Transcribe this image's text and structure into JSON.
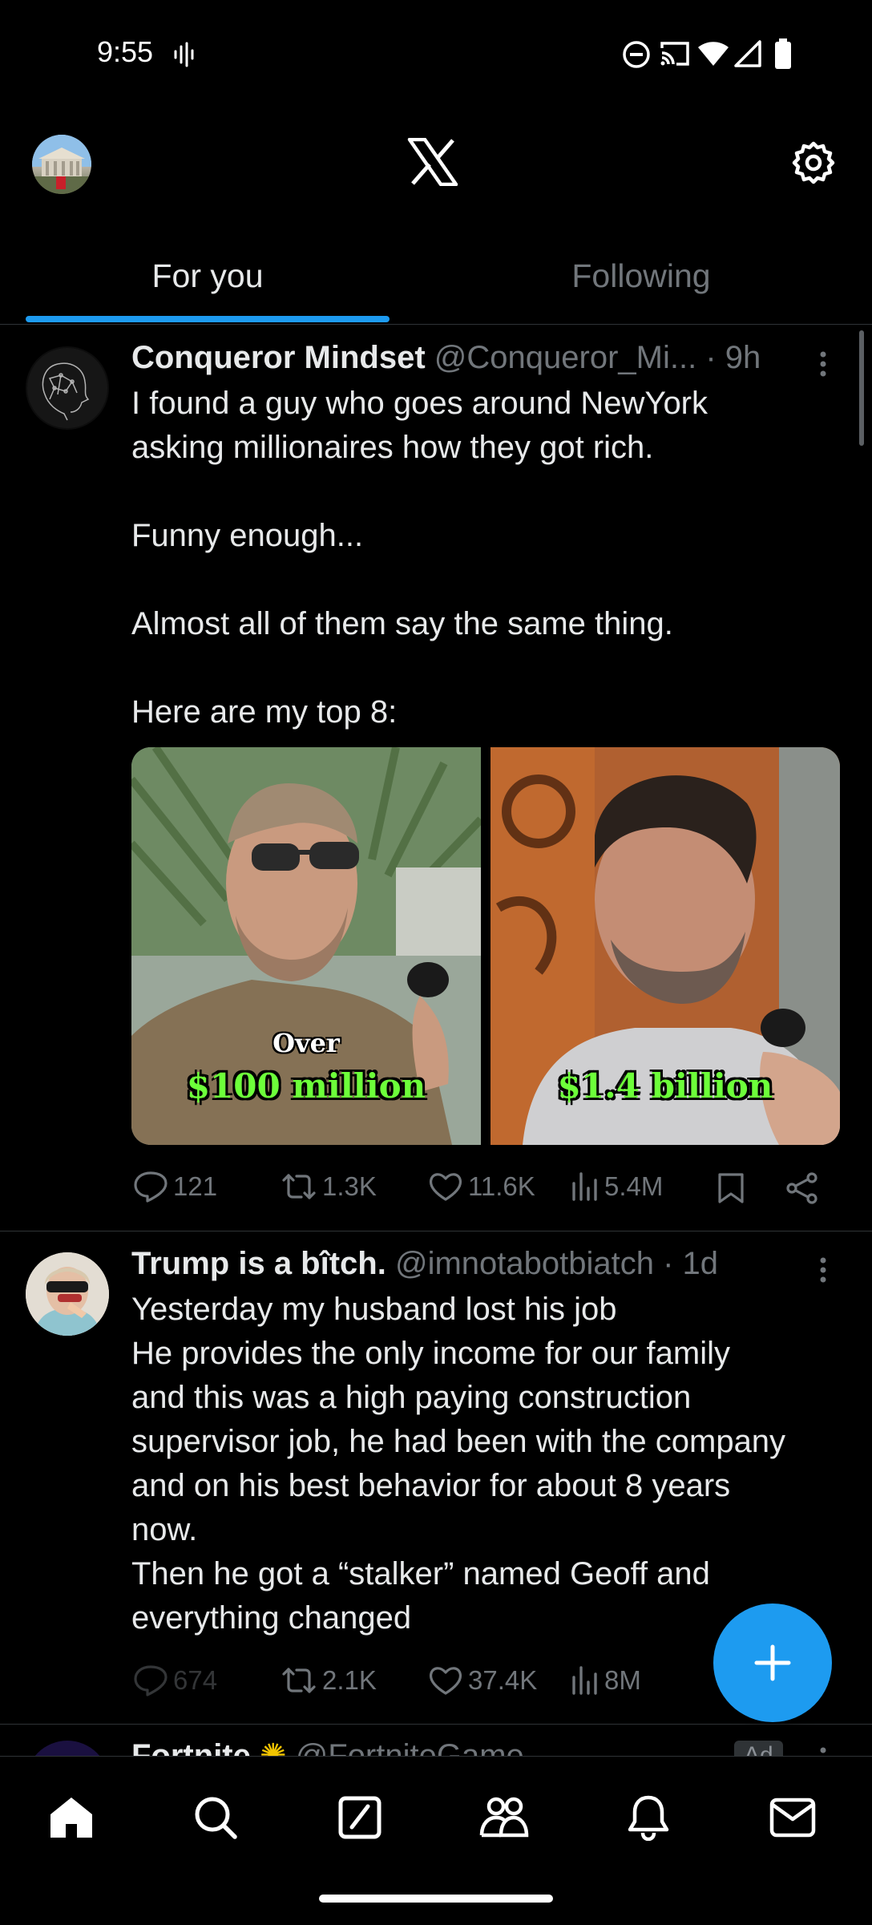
{
  "status_bar": {
    "time": "9:55",
    "icons": [
      "sound-wave-icon",
      "dnd-icon",
      "cast-icon",
      "wifi-icon",
      "signal-icon",
      "battery-icon"
    ]
  },
  "header": {
    "logo": "X",
    "settings_icon": "gear-icon"
  },
  "tabs": [
    {
      "label": "For you",
      "active": true
    },
    {
      "label": "Following",
      "active": false
    }
  ],
  "posts": [
    {
      "name": "Conqueror Mindset",
      "handle": "@Conqueror_Mi...",
      "time": "· 9h",
      "text": "I found a guy who goes around NewYork\nasking millionaires how they got rich.\n\nFunny enough...\n\nAlmost all of them say the same thing.\n\nHere are my top 8:",
      "media": [
        {
          "caption_top": "Over",
          "caption_bottom": "$100 million"
        },
        {
          "caption_top": "",
          "caption_bottom": "$1.4 billion"
        }
      ],
      "replies": "121",
      "reposts": "1.3K",
      "likes": "11.6K",
      "views": "5.4M"
    },
    {
      "name": "Trump is a bîtch.",
      "handle": "@imnotabotbiatch",
      "time": "· 1d",
      "text": "Yesterday my husband lost his job\nHe provides the only income for our family\nand this was a high paying construction\nsupervisor job, he had been with the company\nand on his best behavior for about 8 years\nnow.\nThen he got a “stalker” named Geoff and\neverything changed",
      "replies": "674",
      "reposts": "2.1K",
      "likes": "37.4K",
      "views": "8M"
    },
    {
      "name": "Fortnite",
      "handle": "@FortniteGame",
      "badge": "Ad"
    }
  ],
  "accent_color": "#1d9bf0",
  "bottom_nav": [
    "home-icon",
    "search-icon",
    "grok-icon",
    "communities-icon",
    "notifications-icon",
    "messages-icon"
  ]
}
